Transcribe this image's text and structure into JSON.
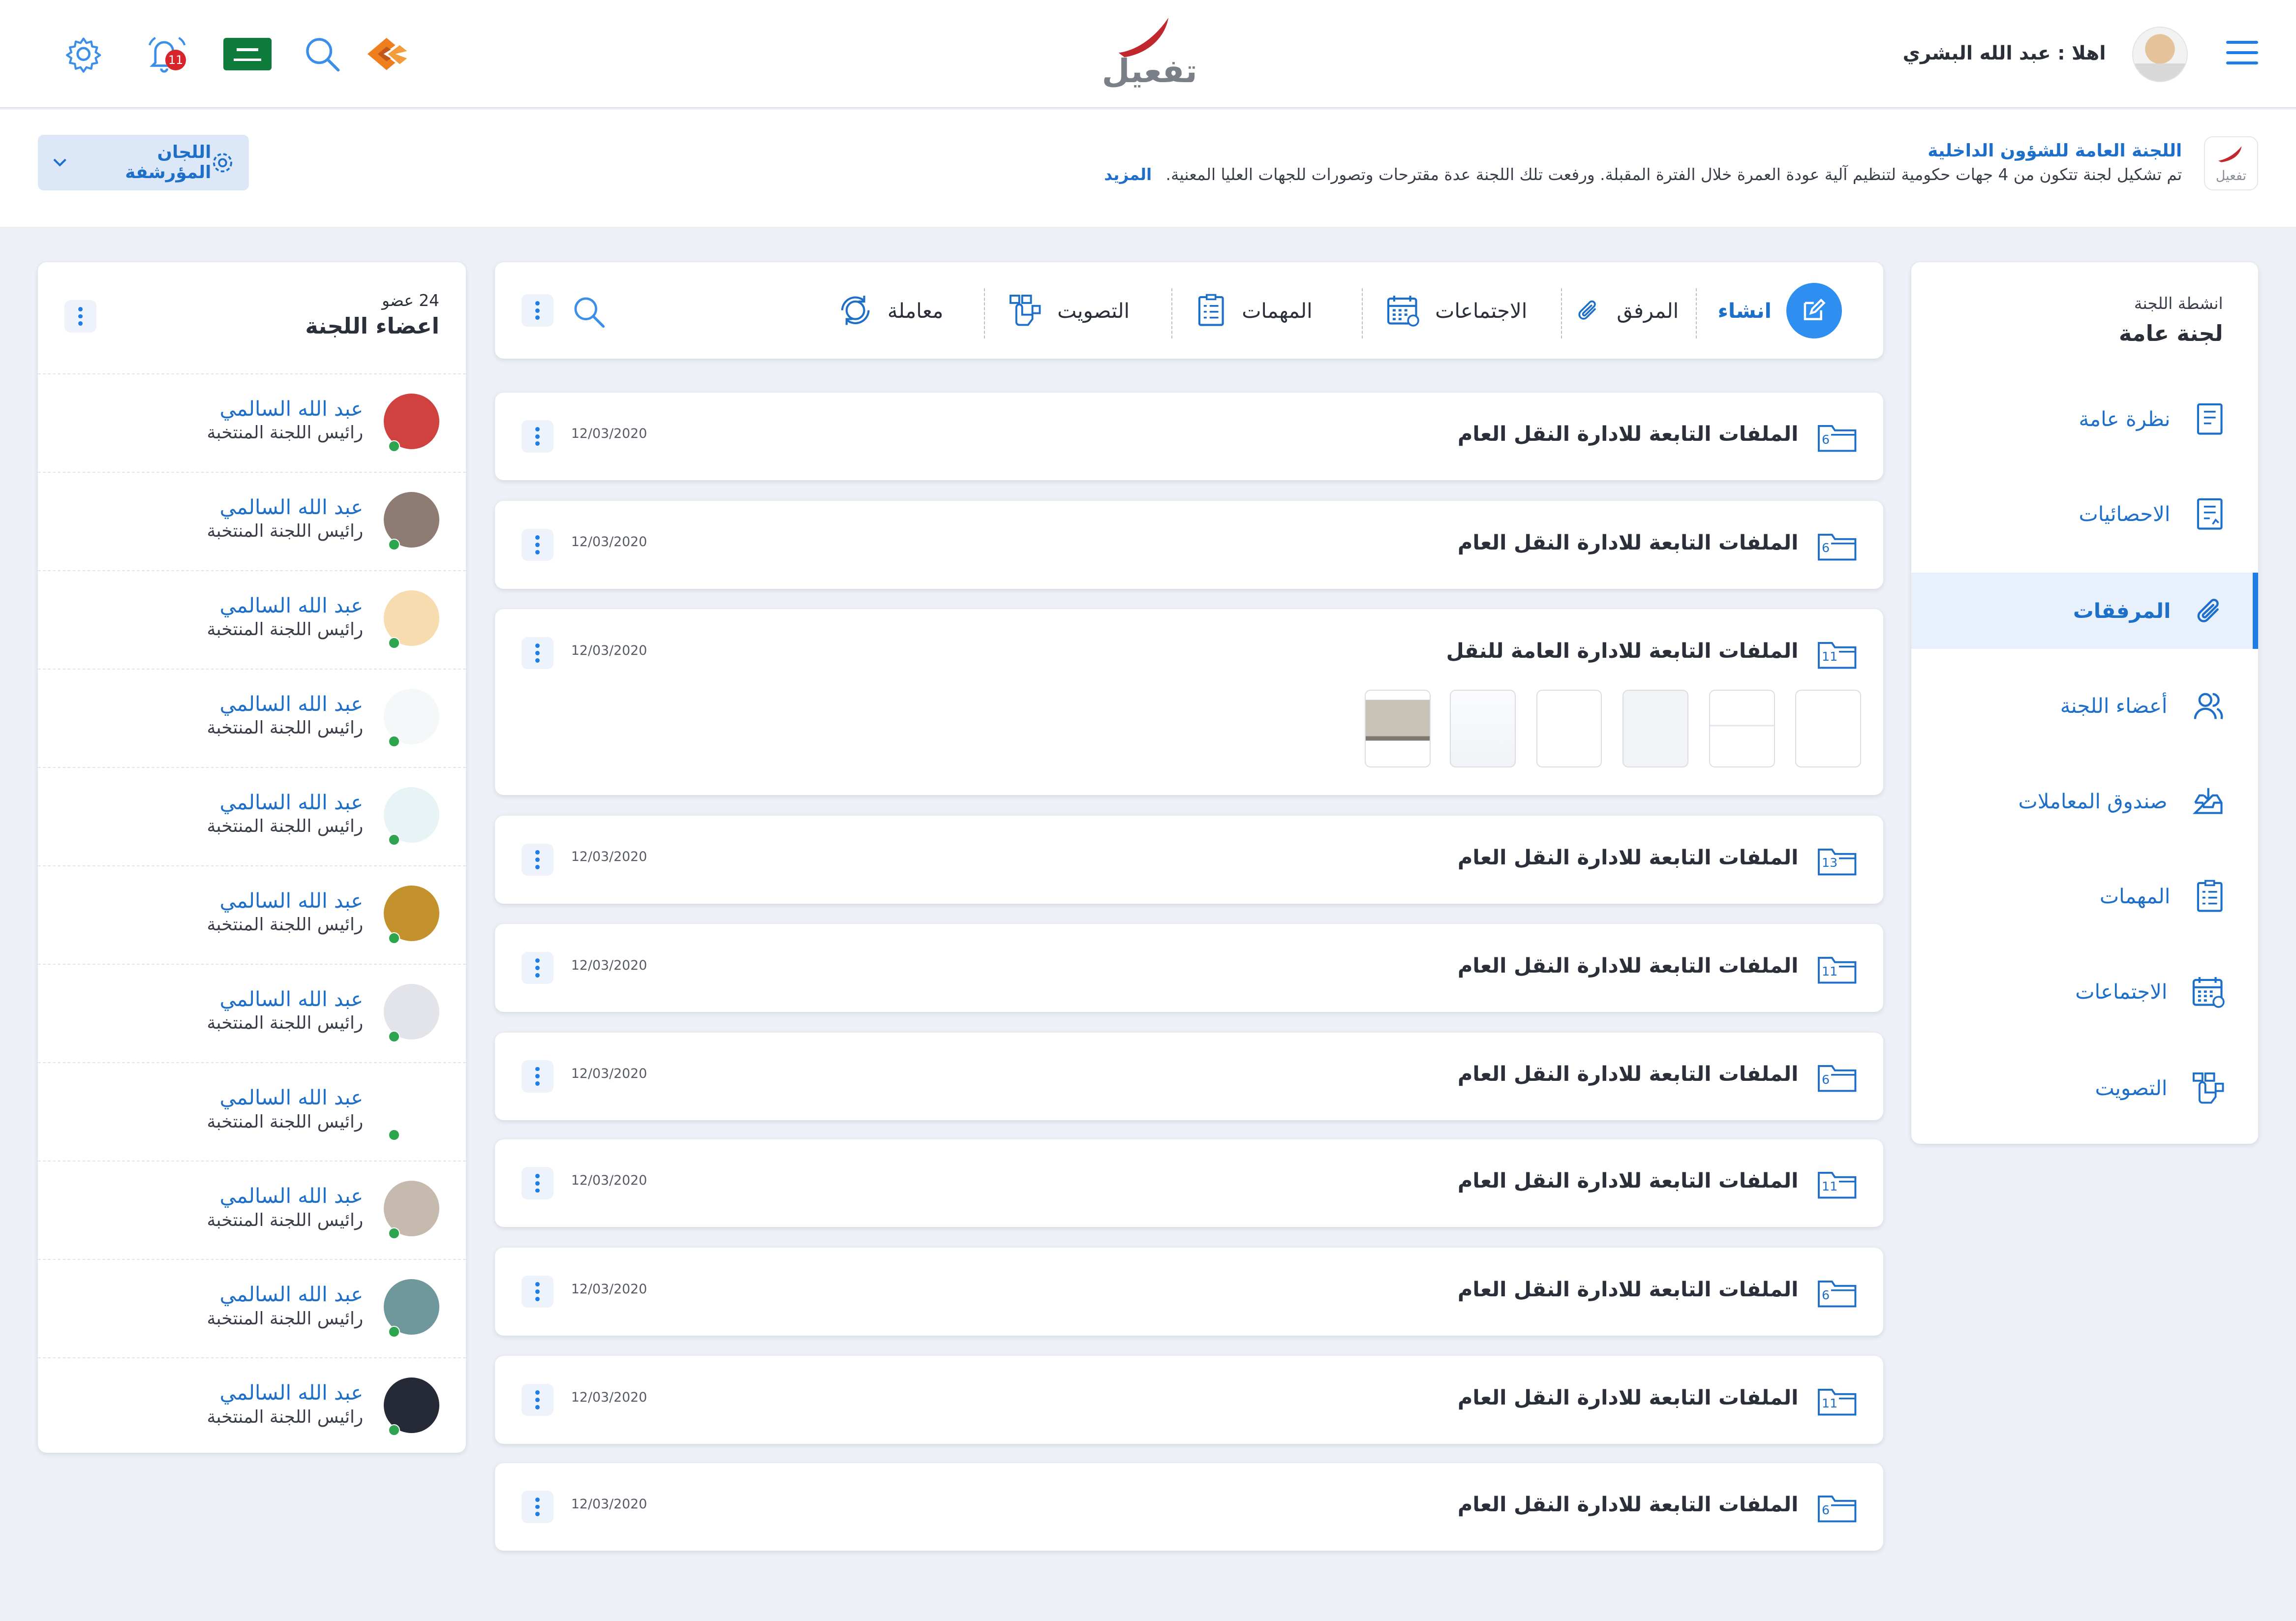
{
  "app": {
    "logo_text": "تفعيل",
    "greeting": "اهلا : عبد الله البشري",
    "notification_count": "11"
  },
  "banner": {
    "logo_text": "تفعيل",
    "title": "اللجنة العامة للشؤون الداخلية",
    "description": "تم تشكيل لجنة تتكون من 4 جهات حكومية لتنظيم آلية عودة العمرة خلال الفترة المقبلة. ورفعت تلك اللجنة عدة مقترحات وتصورات للجهات العليا المعنية.",
    "more_label": "المزيد",
    "archived_label": "اللجان المؤرشفة"
  },
  "sidebar": {
    "subtitle": "انشطة اللجنة",
    "title": "لجنة عامة",
    "items": [
      {
        "label": "نظرة عامة",
        "icon": "document-icon"
      },
      {
        "label": "الاحصائيات",
        "icon": "report-icon"
      },
      {
        "label": "المرفقات",
        "icon": "paperclip-icon",
        "active": true
      },
      {
        "label": "أعضاء اللجنة",
        "icon": "users-icon"
      },
      {
        "label": "صندوق المعاملات",
        "icon": "inbox-icon"
      },
      {
        "label": "المهمات",
        "icon": "checklist-icon"
      },
      {
        "label": "الاجتماعات",
        "icon": "calendar-icon"
      },
      {
        "label": "التصويت",
        "icon": "vote-icon"
      }
    ]
  },
  "toolbar": {
    "create": "انشاء",
    "attachment": "المرفق",
    "meetings": "الاجتماعات",
    "tasks": "المهمات",
    "voting": "التصويت",
    "transaction": "معاملة"
  },
  "files": [
    {
      "title": "الملفات التابعة للادارة النقل العام",
      "count": "6",
      "date": "12/03/2020"
    },
    {
      "title": "الملفات التابعة للادارة النقل العام",
      "count": "6",
      "date": "12/03/2020"
    },
    {
      "title": "الملفات التابعة للادارة العامة للنقل",
      "count": "11",
      "date": "12/03/2020",
      "expanded": true
    },
    {
      "title": "الملفات التابعة للادارة النقل العام",
      "count": "13",
      "date": "12/03/2020"
    },
    {
      "title": "الملفات التابعة للادارة النقل العام",
      "count": "11",
      "date": "12/03/2020"
    },
    {
      "title": "الملفات التابعة للادارة النقل العام",
      "count": "6",
      "date": "12/03/2020"
    },
    {
      "title": "الملفات التابعة للادارة النقل العام",
      "count": "11",
      "date": "12/03/2020"
    },
    {
      "title": "الملفات التابعة للادارة النقل العام",
      "count": "6",
      "date": "12/03/2020"
    },
    {
      "title": "الملفات التابعة للادارة النقل العام",
      "count": "11",
      "date": "12/03/2020"
    },
    {
      "title": "الملفات التابعة للادارة النقل العام",
      "count": "6",
      "date": "12/03/2020"
    }
  ],
  "members_panel": {
    "count": "24 عضو",
    "title": "اعضاء اللجنة",
    "members": [
      {
        "name": "عبد الله السالمي",
        "role": "رائيس اللجنة المنتخبة",
        "color": "#d0423f"
      },
      {
        "name": "عبد الله السالمي",
        "role": "رائيس اللجنة المنتخبة",
        "color": "#8e7b74"
      },
      {
        "name": "عبد الله السالمي",
        "role": "رائيس اللجنة المنتخبة",
        "color": "#f6dcae"
      },
      {
        "name": "عبد الله السالمي",
        "role": "رائيس اللجنة المنتخبة",
        "color": "#f4f8f9"
      },
      {
        "name": "عبد الله السالمي",
        "role": "رائيس اللجنة المنتخبة",
        "color": "#e8f3f6"
      },
      {
        "name": "عبد الله السالمي",
        "role": "رائيس اللجنة المنتخبة",
        "color": "#c4922c"
      },
      {
        "name": "عبد الله السالمي",
        "role": "رائيس اللجنة المنتخبة",
        "color": "#e3e3ea"
      },
      {
        "name": "عبد الله السالمي",
        "role": "رائيس اللجنة المنتخبة",
        "color": "#ffffff"
      },
      {
        "name": "عبد الله السالمي",
        "role": "رائيس اللجنة المنتخبة",
        "color": "#c6b9ad"
      },
      {
        "name": "عبد الله السالمي",
        "role": "رائيس اللجنة المنتخبة",
        "color": "#6f989c"
      },
      {
        "name": "عبد الله السالمي",
        "role": "رائيس اللجنة المنتخبة",
        "color": "#262a36"
      }
    ]
  },
  "colors": {
    "accent": "#1e7de6",
    "brand_red": "#c0282d",
    "online": "#2da44e"
  }
}
